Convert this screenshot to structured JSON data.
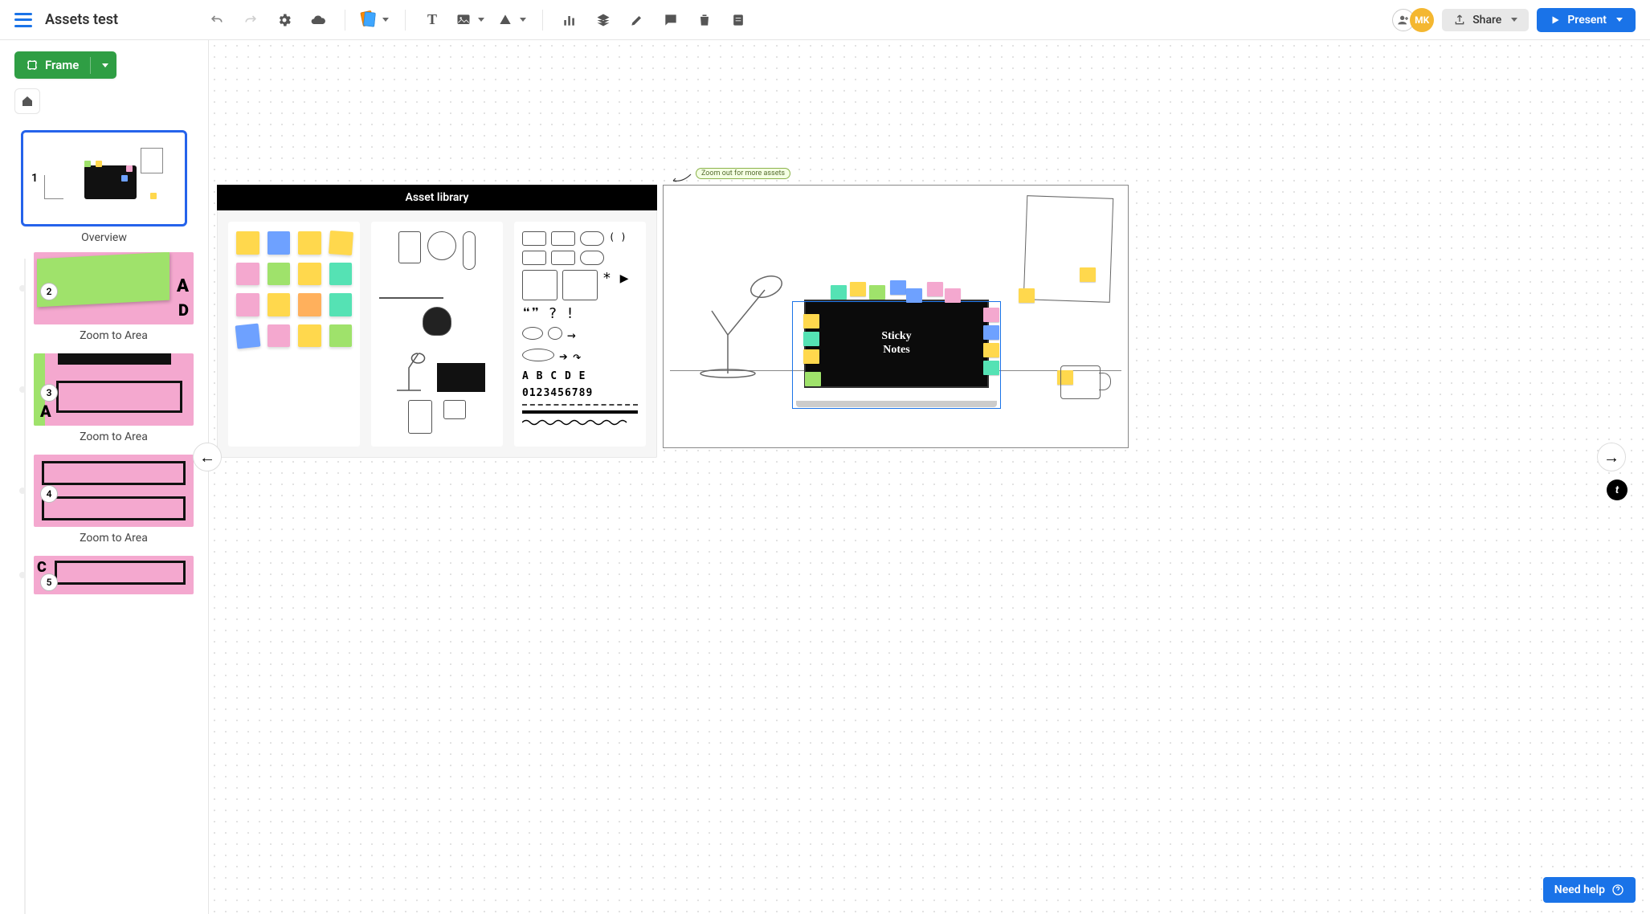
{
  "doc": {
    "title": "Assets test"
  },
  "toolbar": {
    "share_label": "Share",
    "present_label": "Present",
    "avatar_initials": "MK"
  },
  "sidebar": {
    "frame_label": "Frame",
    "overview_label": "Overview",
    "thumbs": [
      {
        "num": "1",
        "caption": "Overview"
      },
      {
        "num": "2",
        "caption": "Zoom to Area"
      },
      {
        "num": "3",
        "caption": "Zoom to Area"
      },
      {
        "num": "4",
        "caption": "Zoom to Area"
      },
      {
        "num": "5",
        "caption": ""
      }
    ]
  },
  "canvas": {
    "asset_library_title": "Asset library",
    "callout_text": "Zoom out for more assets",
    "laptop_text_line1": "Sticky",
    "laptop_text_line2": "Notes",
    "alpha_row": "A B C D E",
    "num_row": "0123456789",
    "paren": "( )",
    "symbols": "* ▶",
    "quotes": "❝❞ ? !"
  },
  "help": {
    "label": "Need help"
  },
  "colors": {
    "green": "#9fe26b",
    "pink": "#f4a8cf",
    "yellow": "#ffd84d",
    "blue": "#6ea1ff",
    "teal": "#55e2b4",
    "orange": "#ffb05c"
  }
}
